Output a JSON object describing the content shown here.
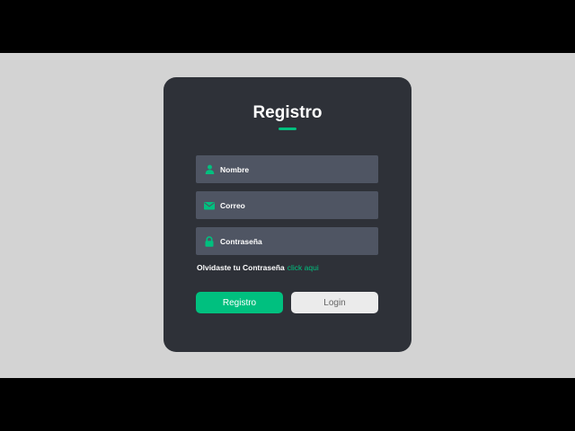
{
  "form": {
    "title": "Registro",
    "fields": [
      {
        "icon": "user-icon",
        "placeholder": "Nombre",
        "value": ""
      },
      {
        "icon": "envelope-icon",
        "placeholder": "Correo",
        "value": ""
      },
      {
        "icon": "lock-icon",
        "placeholder": "Contraseña",
        "value": ""
      }
    ],
    "forgot_text": "Olvidaste tu Contraseña",
    "forgot_link": "click aqui",
    "primary_button": "Registro",
    "secondary_button": "Login"
  },
  "colors": {
    "accent": "#00c07f",
    "card_background": "#2e3138",
    "field_background": "#4f5563",
    "page_background": "#d3d3d3",
    "secondary_button_bg": "#ebebeb"
  }
}
